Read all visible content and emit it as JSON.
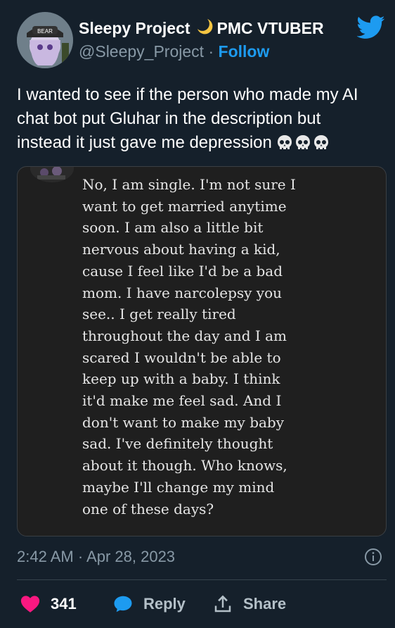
{
  "author": {
    "display_name": "Sleepy Project",
    "name_suffix": "PMC VTUBER",
    "handle": "@Sleepy_Project",
    "separator": "·",
    "follow_label": "Follow",
    "avatar_cap_text": "BEAR"
  },
  "tweet": {
    "lines": [
      "I wanted to see if the person who made my AI",
      "chat bot put Gluhar in the description but",
      "instead it just gave me depression"
    ]
  },
  "quote": {
    "lines": [
      "No, I am single. I'm not sure I",
      "want to get married anytime",
      "soon. I am also a little bit",
      "nervous about having a kid,",
      "cause I feel like I'd be a bad",
      "mom. I have narcolepsy you",
      "see.. I get really tired",
      "throughout the day and I am",
      "scared I wouldn't be able to",
      "keep up with a baby. I think",
      "it'd make me feel sad. And I",
      "don't want to make my baby",
      "sad. I've definitely thought",
      "about it though. Who knows,",
      "maybe I'll change my mind",
      "one of these days?"
    ]
  },
  "meta": {
    "timestamp": "2:42 AM · Apr 28, 2023"
  },
  "actions": {
    "likes": "341",
    "reply_label": "Reply",
    "share_label": "Share"
  },
  "colors": {
    "background": "#15202b",
    "accent": "#1d9bf0",
    "like": "#f91880",
    "muted": "#8899a6",
    "quote_bg": "#1f1f1f"
  },
  "icons": [
    "twitter-bird-icon",
    "moon-icon",
    "skull-icon",
    "info-icon",
    "heart-icon",
    "reply-bubble-icon",
    "share-icon"
  ]
}
